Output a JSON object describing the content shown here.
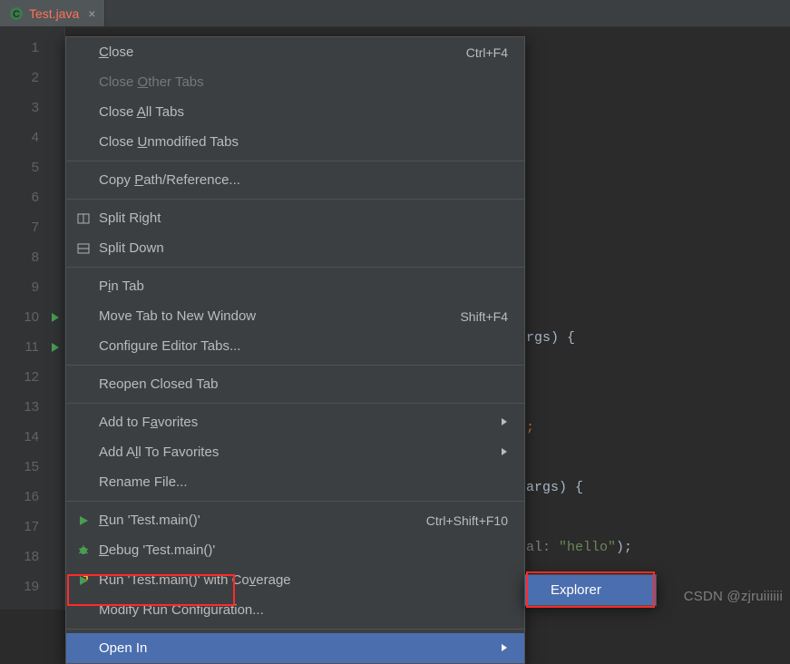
{
  "tab": {
    "name": "Test.java"
  },
  "gutter": {
    "lines": [
      "1",
      "2",
      "3",
      "4",
      "5",
      "6",
      "7",
      "8",
      "9",
      "10",
      "11",
      "12",
      "13",
      "14",
      "15",
      "16",
      "17",
      "18",
      "19"
    ],
    "run_markers": [
      10,
      11
    ]
  },
  "code": {
    "frag_args_brace": "rgs) {",
    "frag_args_brace2": "args) {",
    "frag_colon": ";",
    "frag_al": "al: ",
    "frag_hello": "\"hello\"",
    "frag_close": ");"
  },
  "menu": {
    "items": [
      {
        "label_pre": "",
        "mn": "C",
        "label_post": "lose",
        "shortcut": "Ctrl+F4",
        "icon": "",
        "has_sub": false,
        "disabled": false
      },
      {
        "label_pre": "Close ",
        "mn": "O",
        "label_post": "ther Tabs",
        "shortcut": "",
        "icon": "",
        "has_sub": false,
        "disabled": true
      },
      {
        "label_pre": "Close ",
        "mn": "A",
        "label_post": "ll Tabs",
        "shortcut": "",
        "icon": "",
        "has_sub": false,
        "disabled": false
      },
      {
        "label_pre": "Close ",
        "mn": "U",
        "label_post": "nmodified Tabs",
        "shortcut": "",
        "icon": "",
        "has_sub": false,
        "disabled": false
      },
      {
        "sep": true
      },
      {
        "label_pre": "Copy ",
        "mn": "P",
        "label_post": "ath/Reference...",
        "shortcut": "",
        "icon": "",
        "has_sub": false,
        "disabled": false
      },
      {
        "sep": true
      },
      {
        "label_pre": "Split Right",
        "mn": "",
        "label_post": "",
        "shortcut": "",
        "icon": "split-right",
        "has_sub": false,
        "disabled": false
      },
      {
        "label_pre": "Split Down",
        "mn": "",
        "label_post": "",
        "shortcut": "",
        "icon": "split-down",
        "has_sub": false,
        "disabled": false
      },
      {
        "sep": true
      },
      {
        "label_pre": "P",
        "mn": "i",
        "label_post": "n Tab",
        "shortcut": "",
        "icon": "",
        "has_sub": false,
        "disabled": false
      },
      {
        "label_pre": "Move Tab to New Window",
        "mn": "",
        "label_post": "",
        "shortcut": "Shift+F4",
        "icon": "",
        "has_sub": false,
        "disabled": false
      },
      {
        "label_pre": "Configure Editor Tabs...",
        "mn": "",
        "label_post": "",
        "shortcut": "",
        "icon": "",
        "has_sub": false,
        "disabled": false
      },
      {
        "sep": true
      },
      {
        "label_pre": "Reopen Closed Tab",
        "mn": "",
        "label_post": "",
        "shortcut": "",
        "icon": "",
        "has_sub": false,
        "disabled": false
      },
      {
        "sep": true
      },
      {
        "label_pre": "Add to F",
        "mn": "a",
        "label_post": "vorites",
        "shortcut": "",
        "icon": "",
        "has_sub": true,
        "disabled": false
      },
      {
        "label_pre": "Add A",
        "mn": "l",
        "label_post": "l To Favorites",
        "shortcut": "",
        "icon": "",
        "has_sub": true,
        "disabled": false
      },
      {
        "label_pre": "Rename File...",
        "mn": "",
        "label_post": "",
        "shortcut": "",
        "icon": "",
        "has_sub": false,
        "disabled": false
      },
      {
        "sep": true
      },
      {
        "label_pre": "",
        "mn": "R",
        "label_post": "un 'Test.main()'",
        "shortcut": "Ctrl+Shift+F10",
        "icon": "run",
        "has_sub": false,
        "disabled": false
      },
      {
        "label_pre": "",
        "mn": "D",
        "label_post": "ebug 'Test.main()'",
        "shortcut": "",
        "icon": "debug",
        "has_sub": false,
        "disabled": false
      },
      {
        "label_pre": "Run 'Test.main()' with Co",
        "mn": "v",
        "label_post": "erage",
        "shortcut": "",
        "icon": "coverage",
        "has_sub": false,
        "disabled": false
      },
      {
        "label_pre": "Modify Run Configuration...",
        "mn": "",
        "label_post": "",
        "shortcut": "",
        "icon": "",
        "has_sub": false,
        "disabled": false
      },
      {
        "sep": true
      },
      {
        "label_pre": "Open In",
        "mn": "",
        "label_post": "",
        "shortcut": "",
        "icon": "",
        "has_sub": true,
        "disabled": false,
        "selected": true
      }
    ]
  },
  "submenu": {
    "items": [
      {
        "label": "Explorer"
      }
    ]
  },
  "watermark": "CSDN @zjruiiiiii"
}
